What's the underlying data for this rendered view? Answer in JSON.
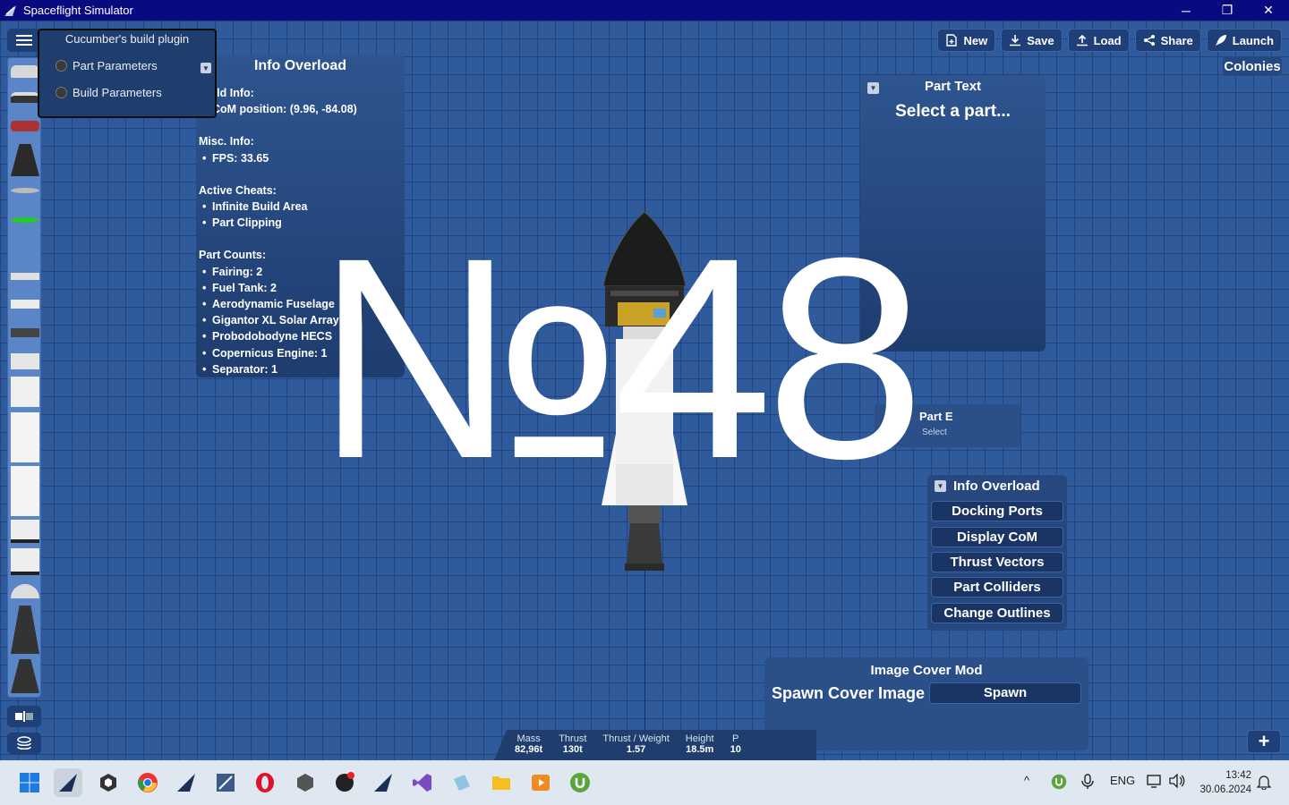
{
  "window": {
    "title": "Spaceflight Simulator",
    "minimize": "─",
    "restore": "❐",
    "close": "✕"
  },
  "plugin": {
    "title": "Cucumber's build plugin",
    "items": [
      "Part Parameters",
      "Build Parameters"
    ]
  },
  "info_overload": {
    "title": "Info Overload",
    "build_info_heading": "Build Info:",
    "build_info": [
      "CoM position: (9.96, -84.08)"
    ],
    "misc_heading": "Misc. Info:",
    "misc": [
      "FPS: 33.65"
    ],
    "cheats_heading": "Active Cheats:",
    "cheats": [
      "Infinite Build Area",
      "Part Clipping"
    ],
    "counts_heading": "Part Counts:",
    "counts": [
      "Fairing: 2",
      "Fuel Tank: 2",
      "Aerodynamic Fuselage",
      "Gigantor XL Solar Array",
      "Probodobodyne HECS",
      "Copernicus Engine: 1",
      "Separator: 1"
    ]
  },
  "toolbar": {
    "new": "New",
    "save": "Save",
    "load": "Load",
    "share": "Share",
    "launch": "Launch",
    "colonies": "Colonies"
  },
  "part_text": {
    "title": "Part Text",
    "subtitle": "Select a part..."
  },
  "part_e": {
    "title": "Part E",
    "subtitle": "Select"
  },
  "overlay_menu": {
    "title": "Info Overload",
    "buttons": [
      "Docking Ports",
      "Display CoM",
      "Thrust Vectors",
      "Part Colliders",
      "Change Outlines"
    ]
  },
  "image_cover": {
    "title": "Image Cover Mod",
    "label": "Spawn Cover Image",
    "button": "Spawn"
  },
  "stats": [
    {
      "label": "Mass",
      "value": "82,96t"
    },
    {
      "label": "Thrust",
      "value": "130t"
    },
    {
      "label": "Thrust / Weight",
      "value": "1.57"
    },
    {
      "label": "Height",
      "value": "18.5m"
    },
    {
      "label": "P",
      "value": "10"
    }
  ],
  "watermark": "№48",
  "taskbar": {
    "lang": "ENG",
    "time": "13:42",
    "date": "30.06.2024"
  },
  "colors": {
    "background": "#2f5a9c",
    "panel": "#1f3e6e",
    "titlebar": "#0a0a80"
  }
}
